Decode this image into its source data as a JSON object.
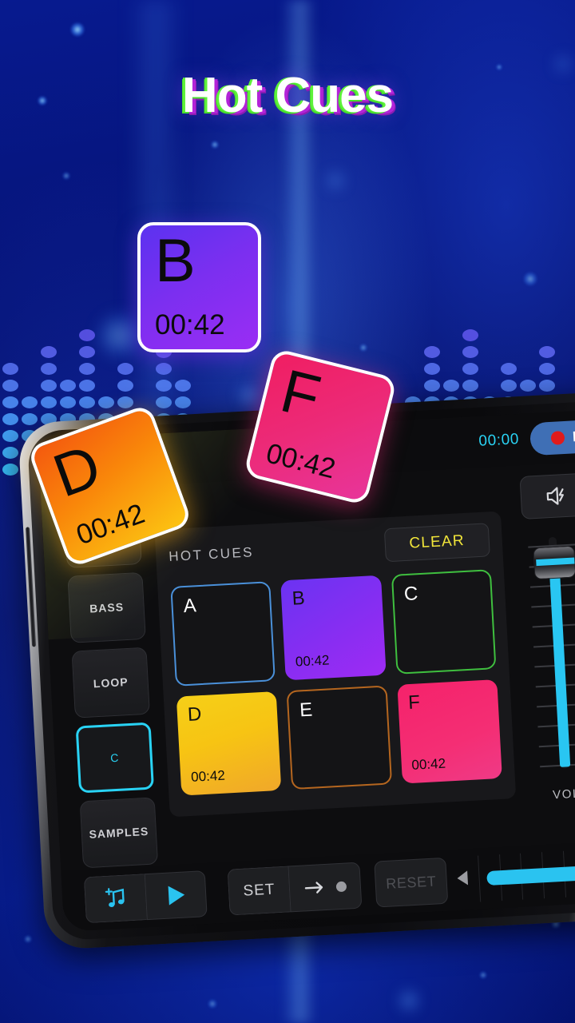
{
  "promo": {
    "title": "Hot Cues"
  },
  "floating_pads": [
    {
      "letter": "B",
      "time": "00:42",
      "color": "#7b2ff0"
    },
    {
      "letter": "F",
      "time": "00:42",
      "color": "#ec2a78"
    },
    {
      "letter": "D",
      "time": "00:42",
      "color": "#f9870a"
    }
  ],
  "app": {
    "topbar": {
      "time": "00:00",
      "record_label": "R"
    },
    "rail": [
      {
        "label": "",
        "active": false
      },
      {
        "label": "BASS",
        "active": false
      },
      {
        "label": "LOOP",
        "active": false
      },
      {
        "label": "C",
        "active": true
      },
      {
        "label": "SAMPLES",
        "active": false
      }
    ],
    "cues": {
      "title": "HOT CUES",
      "clear_label": "CLEAR",
      "pads": [
        {
          "letter": "A",
          "time": "",
          "filled": false,
          "color": "#4a90d9"
        },
        {
          "letter": "B",
          "time": "00:42",
          "filled": true,
          "color": "#7b2ff0"
        },
        {
          "letter": "C",
          "time": "",
          "filled": false,
          "color": "#3fbf3f"
        },
        {
          "letter": "D",
          "time": "00:42",
          "filled": true,
          "color": "#f5c518"
        },
        {
          "letter": "E",
          "time": "",
          "filled": false,
          "color": "#b5661f"
        },
        {
          "letter": "F",
          "time": "00:42",
          "filled": true,
          "color": "#f52b6e"
        }
      ]
    },
    "mixer": {
      "vol_label": "VOL",
      "volume_percent": 100,
      "vu_segments_lit": 6,
      "vu_segments_total": 11
    },
    "transport": {
      "set_label": "SET",
      "reset_label": "RESET",
      "progress_percent": 88
    },
    "colors": {
      "accent_cyan": "#29c6f2",
      "clear_yellow": "#f2e63a",
      "record_blue": "#3f6fb5",
      "record_red": "#e01b1b"
    }
  }
}
